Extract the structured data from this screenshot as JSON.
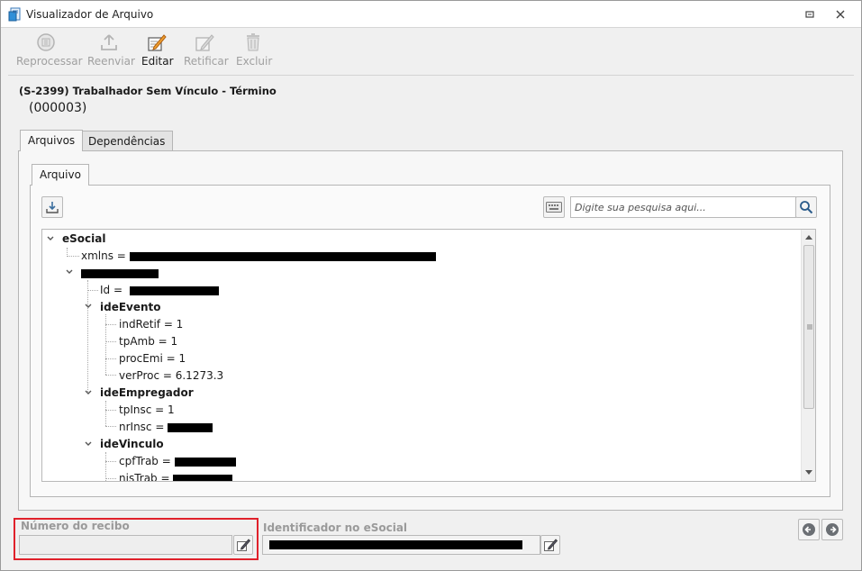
{
  "window": {
    "title": "Visualizador de Arquivo"
  },
  "toolbar": {
    "items": [
      {
        "label": "Reprocessar",
        "icon": "reprocess-icon",
        "enabled": false
      },
      {
        "label": "Reenviar",
        "icon": "upload-icon",
        "enabled": false
      },
      {
        "label": "Editar",
        "icon": "edit-icon",
        "enabled": true
      },
      {
        "label": "Retificar",
        "icon": "rectify-icon",
        "enabled": false
      },
      {
        "label": "Excluir",
        "icon": "trash-icon",
        "enabled": false
      }
    ]
  },
  "event": {
    "title": "(S-2399) Trabalhador Sem Vínculo - Término",
    "code": "(000003)"
  },
  "tabs": [
    {
      "label": "Arquivos",
      "selected": true
    },
    {
      "label": "Dependências",
      "selected": false
    }
  ],
  "inner_tab": {
    "label": "Arquivo"
  },
  "search": {
    "placeholder": "Digite sua pesquisa aqui..."
  },
  "tree": {
    "nodes": [
      {
        "label": "eSocial"
      },
      {
        "label": "xmlns = "
      },
      {
        "label": "Id = "
      },
      {
        "label": "ideEvento"
      },
      {
        "label": "indRetif = 1"
      },
      {
        "label": "tpAmb = 1"
      },
      {
        "label": "procEmi = 1"
      },
      {
        "label": "verProc = 6.1273.3"
      },
      {
        "label": "ideEmpregador"
      },
      {
        "label": "tpInsc = 1"
      },
      {
        "label": "nrInsc = "
      },
      {
        "label": "ideVinculo"
      },
      {
        "label": "cpfTrab = "
      },
      {
        "label": "nisTrab = "
      }
    ]
  },
  "fields": {
    "receipt": {
      "label": "Número do recibo",
      "value": ""
    },
    "identifier": {
      "label": "Identificador no eSocial"
    }
  },
  "colors": {
    "highlight": "#e0212b",
    "disabled_text": "#a0a0a0"
  }
}
